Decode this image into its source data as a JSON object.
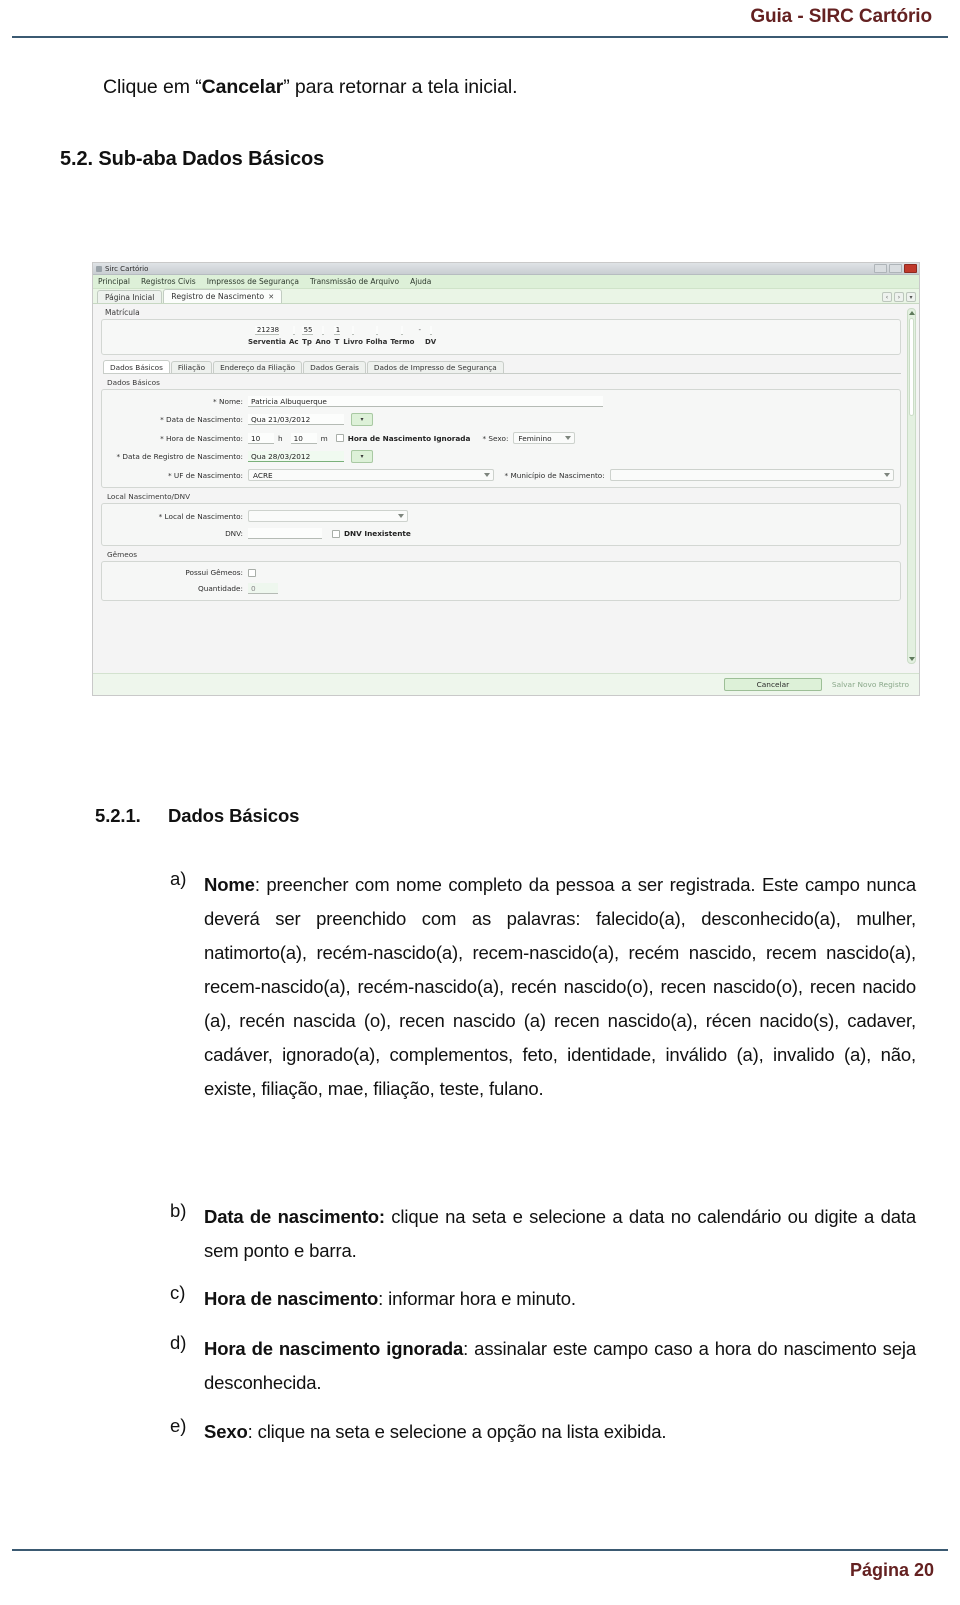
{
  "document": {
    "header_title": "Guia - SIRC Cartório",
    "footer_page": "Página 20",
    "accent_color": "#642121",
    "rule_color": "#3b5a72"
  },
  "intro": {
    "prefix": "Clique em “",
    "bold": "Cancelar",
    "suffix": "” para retornar a tela inicial."
  },
  "sections": {
    "s52": "5.2. Sub-aba Dados Básicos",
    "s521_number": "5.2.1.",
    "s521_title": "Dados Básicos"
  },
  "list": [
    {
      "marker": "a)",
      "bold": "Nome",
      "text": ": preencher com nome completo da pessoa a ser registrada. Este campo nunca deverá ser preenchido com as palavras: falecido(a), desconhecido(a), mulher, natimorto(a), recém-nascido(a), recem-nascido(a), recém nascido, recem nascido(a), recem-nascido(a), recém-nascido(a), recén nascido(o), recen nascido(o), recen nacido (a), recén nascida (o), recen nascido (a) recen nascido(a), récen  nacido(s),  cadaver, cadáver, ignorado(a), complementos, feto, identidade, inválido (a), invalido (a), não, existe, filiação, mae, filiação, teste, fulano."
    },
    {
      "marker": "b)",
      "bold": "Data de nascimento:",
      "text": " clique na seta e selecione a data no calendário ou digite a data sem ponto e barra."
    },
    {
      "marker": "c)",
      "bold": "Hora de nascimento",
      "text": ": informar hora e  minuto."
    },
    {
      "marker": "d)",
      "bold": "Hora de nascimento ignorada",
      "text": ": assinalar este campo caso a hora do nascimento seja desconhecida."
    },
    {
      "marker": "e)",
      "bold": "Sexo",
      "text": ": clique na seta e selecione a opção na lista exibida."
    }
  ],
  "app": {
    "window_title": "Sirc Cartório",
    "menu": [
      "Principal",
      "Registros Civis",
      "Impressos de Segurança",
      "Transmissão de Arquivo",
      "Ajuda"
    ],
    "tabs": [
      {
        "label": "Página Inicial",
        "active": false,
        "close": ""
      },
      {
        "label": "Registro de Nascimento",
        "active": true,
        "close": "✕"
      }
    ],
    "tab_nav": [
      "‹",
      "›",
      "▾"
    ],
    "matricula": {
      "group_title": "Matrícula",
      "fields": [
        {
          "label": "Serventia",
          "value": "21238"
        },
        {
          "label": "Ac",
          "value": ""
        },
        {
          "label": "Tp",
          "value": "55"
        },
        {
          "label": "Ano",
          "value": ""
        },
        {
          "label": "T",
          "value": "1"
        },
        {
          "label": "Livro",
          "value": ""
        },
        {
          "label": "Folha",
          "value": ""
        },
        {
          "label": "Termo",
          "value": ""
        },
        {
          "label": "DV",
          "value": ""
        }
      ],
      "separator": "-"
    },
    "subtabs": [
      {
        "label": "Dados Básicos",
        "active": true
      },
      {
        "label": "Filiação",
        "active": false
      },
      {
        "label": "Endereço da Filiação",
        "active": false
      },
      {
        "label": "Dados Gerais",
        "active": false
      },
      {
        "label": "Dados de Impresso de Segurança",
        "active": false
      }
    ],
    "panel_dados_basicos": {
      "panel_label": "Dados Básicos",
      "nome_label": "* Nome:",
      "nome_value": "Patricia Albuquerque",
      "data_nasc_label": "* Data de Nascimento:",
      "data_nasc_value": "Qua 21/03/2012",
      "hora_nasc_label": "* Hora de Nascimento:",
      "hora_value": "10",
      "hora_unit": "h",
      "minuto_value": "10",
      "minuto_unit": "m",
      "hora_ignorada_label": "Hora de Nascimento Ignorada",
      "sexo_label": "* Sexo:",
      "sexo_value": "Feminino",
      "data_reg_label": "* Data de Registro de Nascimento:",
      "data_reg_value": "Qua 28/03/2012",
      "uf_label": "* UF de Nascimento:",
      "uf_value": "ACRE",
      "municipio_label": "* Município de Nascimento:",
      "municipio_value": ""
    },
    "panel_local_dnv": {
      "panel_label": "Local Nascimento/DNV",
      "local_label": "* Local de Nascimento:",
      "local_value": "",
      "dnv_label": "DNV:",
      "dnv_value": "",
      "dnv_inexistente_label": "DNV Inexistente"
    },
    "panel_gemeos": {
      "panel_label": "Gêmeos",
      "possui_label": "Possui Gêmeos:",
      "quantidade_label": "Quantidade:",
      "quantidade_value": "0"
    },
    "actions": {
      "cancel": "Cancelar",
      "save": "Salvar Novo Registro"
    },
    "calendar_glyph": "▾"
  }
}
